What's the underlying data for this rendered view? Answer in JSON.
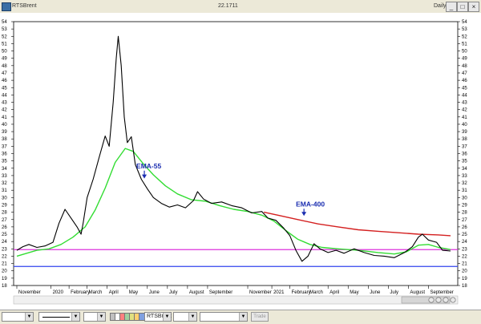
{
  "window": {
    "name": "RTSBrent",
    "last_value": "22.1711",
    "period": "Daily",
    "btn_min": "_",
    "btn_max": "□",
    "btn_close": "×"
  },
  "toolbar": {
    "symbol": "RTSBrent",
    "trade_label": "Trade",
    "swatch_colors": [
      "#c0c0c0",
      "#ffffff",
      "#ff8080",
      "#9fd09f",
      "#e0e080",
      "#ffd070",
      "#80a0e0"
    ]
  },
  "colors": {
    "price": "#000000",
    "ema55": "#33dd33",
    "ema400": "#d42020",
    "magenta_line": "#dd33dd",
    "blue_line": "#3344ee",
    "annotation": "#1a2db0"
  },
  "chart_data": {
    "type": "line",
    "title": "",
    "xlabel": "",
    "ylabel": "",
    "ylim": [
      18,
      54
    ],
    "y_ticks": [
      18,
      19,
      20,
      21,
      22,
      23,
      24,
      25,
      26,
      27,
      28,
      29,
      30,
      31,
      32,
      33,
      34,
      35,
      36,
      37,
      38,
      39,
      40,
      41,
      42,
      43,
      44,
      45,
      46,
      47,
      48,
      49,
      50,
      51,
      52,
      53,
      54
    ],
    "x_ticks": [
      {
        "label": "November",
        "t": 0
      },
      {
        "label": "2020",
        "t": 1.7
      },
      {
        "label": "February",
        "t": 2.6
      },
      {
        "label": "March",
        "t": 3.5
      },
      {
        "label": "April",
        "t": 4.5
      },
      {
        "label": "May",
        "t": 5.5
      },
      {
        "label": "June",
        "t": 6.5
      },
      {
        "label": "July",
        "t": 7.5
      },
      {
        "label": "August",
        "t": 8.5
      },
      {
        "label": "September",
        "t": 9.5
      },
      {
        "label": "November",
        "t": 11.5
      },
      {
        "label": "2021",
        "t": 12.7
      },
      {
        "label": "February",
        "t": 13.6
      },
      {
        "label": "March",
        "t": 14.5
      },
      {
        "label": "April",
        "t": 15.5
      },
      {
        "label": "May",
        "t": 16.5
      },
      {
        "label": "June",
        "t": 17.5
      },
      {
        "label": "July",
        "t": 18.5
      },
      {
        "label": "August",
        "t": 19.5
      },
      {
        "label": "September",
        "t": 20.5
      }
    ],
    "series": [
      {
        "key": "price",
        "points": [
          [
            0,
            22.8
          ],
          [
            0.3,
            23.3
          ],
          [
            0.6,
            23.6
          ],
          [
            1,
            23.2
          ],
          [
            1.4,
            23.4
          ],
          [
            1.8,
            23.9
          ],
          [
            2.1,
            26.5
          ],
          [
            2.4,
            28.4
          ],
          [
            2.7,
            27.2
          ],
          [
            3.0,
            26.0
          ],
          [
            3.2,
            25.0
          ],
          [
            3.3,
            26.5
          ],
          [
            3.5,
            30.0
          ],
          [
            3.8,
            32.5
          ],
          [
            4.1,
            35.5
          ],
          [
            4.4,
            38.4
          ],
          [
            4.6,
            37.0
          ],
          [
            4.8,
            43.0
          ],
          [
            4.95,
            49.0
          ],
          [
            5.05,
            52.0
          ],
          [
            5.2,
            48.0
          ],
          [
            5.35,
            41.0
          ],
          [
            5.5,
            37.5
          ],
          [
            5.7,
            38.3
          ],
          [
            5.9,
            34.5
          ],
          [
            6.2,
            32.5
          ],
          [
            6.5,
            31.2
          ],
          [
            6.8,
            30.0
          ],
          [
            7.2,
            29.2
          ],
          [
            7.6,
            28.7
          ],
          [
            8.0,
            29.0
          ],
          [
            8.4,
            28.6
          ],
          [
            8.8,
            29.6
          ],
          [
            9.0,
            30.8
          ],
          [
            9.3,
            29.8
          ],
          [
            9.7,
            29.2
          ],
          [
            10.2,
            29.4
          ],
          [
            10.7,
            28.9
          ],
          [
            11.2,
            28.6
          ],
          [
            11.7,
            27.9
          ],
          [
            12.2,
            28.1
          ],
          [
            12.5,
            27.2
          ],
          [
            12.9,
            26.9
          ],
          [
            13.3,
            25.8
          ],
          [
            13.6,
            24.8
          ],
          [
            13.9,
            22.8
          ],
          [
            14.2,
            21.3
          ],
          [
            14.5,
            22.0
          ],
          [
            14.8,
            23.7
          ],
          [
            15.1,
            23.0
          ],
          [
            15.5,
            22.5
          ],
          [
            15.9,
            22.8
          ],
          [
            16.3,
            22.4
          ],
          [
            16.8,
            23.0
          ],
          [
            17.3,
            22.5
          ],
          [
            17.8,
            22.1
          ],
          [
            18.3,
            22.0
          ],
          [
            18.8,
            21.8
          ],
          [
            19.3,
            22.5
          ],
          [
            19.7,
            23.3
          ],
          [
            20.0,
            24.6
          ],
          [
            20.2,
            25.0
          ],
          [
            20.5,
            24.2
          ],
          [
            20.9,
            23.9
          ],
          [
            21.2,
            22.8
          ],
          [
            21.6,
            22.7
          ]
        ]
      },
      {
        "key": "ema55",
        "points": [
          [
            0,
            22.0
          ],
          [
            1,
            22.8
          ],
          [
            1.6,
            23.0
          ],
          [
            2.2,
            23.6
          ],
          [
            2.8,
            24.6
          ],
          [
            3.4,
            26.0
          ],
          [
            3.9,
            28.3
          ],
          [
            4.4,
            31.3
          ],
          [
            4.9,
            34.8
          ],
          [
            5.4,
            36.7
          ],
          [
            5.8,
            36.3
          ],
          [
            6.3,
            34.6
          ],
          [
            6.8,
            33.1
          ],
          [
            7.4,
            31.6
          ],
          [
            8.0,
            30.5
          ],
          [
            8.7,
            29.7
          ],
          [
            9.4,
            29.5
          ],
          [
            10.1,
            28.9
          ],
          [
            10.8,
            28.4
          ],
          [
            11.5,
            28.1
          ],
          [
            12.2,
            27.6
          ],
          [
            12.8,
            26.8
          ],
          [
            13.4,
            25.5
          ],
          [
            14.0,
            24.3
          ],
          [
            14.6,
            23.6
          ],
          [
            15.2,
            23.2
          ],
          [
            16.0,
            23.0
          ],
          [
            17.0,
            22.8
          ],
          [
            18.0,
            22.5
          ],
          [
            18.8,
            22.3
          ],
          [
            19.4,
            22.6
          ],
          [
            20.0,
            23.5
          ],
          [
            20.5,
            23.6
          ],
          [
            21.0,
            23.2
          ],
          [
            21.6,
            22.9
          ]
        ]
      },
      {
        "key": "ema400",
        "points": [
          [
            12.3,
            28.0
          ],
          [
            13.0,
            27.6
          ],
          [
            14.0,
            27.0
          ],
          [
            15.0,
            26.4
          ],
          [
            16.0,
            26.0
          ],
          [
            17.0,
            25.6
          ],
          [
            18.0,
            25.4
          ],
          [
            19.0,
            25.2
          ],
          [
            20.0,
            25.0
          ],
          [
            21.0,
            24.9
          ],
          [
            21.6,
            24.8
          ]
        ]
      }
    ],
    "horizontal_lines": [
      {
        "key": "magenta_line",
        "y": 22.9
      },
      {
        "key": "blue_line",
        "y": 20.6
      }
    ],
    "annotations": [
      {
        "label": "EMA-55",
        "t": 6.35,
        "y": 34.0,
        "arrow_to": 32.7
      },
      {
        "label": "EMA-400",
        "t": 14.3,
        "y": 28.8,
        "arrow_to": 27.6
      }
    ]
  }
}
